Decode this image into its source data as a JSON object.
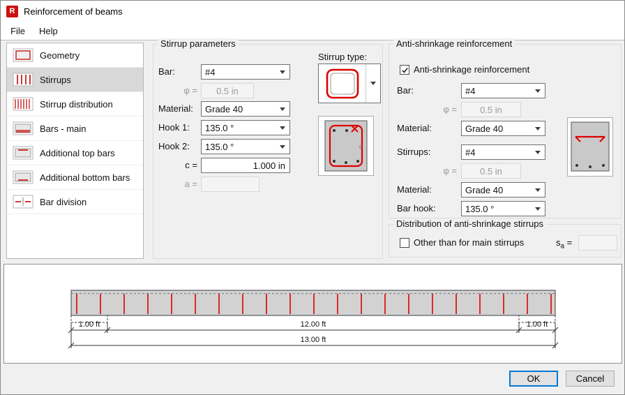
{
  "colors": {
    "accent_red": "#cc1111",
    "focus_blue": "#0078d7",
    "selection_gray": "#d8d8d8",
    "stirrup_red": "#dd0000"
  },
  "window": {
    "title": "Reinforcement of beams",
    "icon_letter": "R"
  },
  "menu": {
    "items": [
      {
        "label": "File"
      },
      {
        "label": "Help"
      }
    ]
  },
  "sidebar": {
    "selected": "Stirrups",
    "items": [
      {
        "label": "Geometry"
      },
      {
        "label": "Stirrups"
      },
      {
        "label": "Stirrup distribution"
      },
      {
        "label": "Bars - main"
      },
      {
        "label": "Additional top bars"
      },
      {
        "label": "Additional bottom bars"
      },
      {
        "label": "Bar division"
      }
    ]
  },
  "stirrup_parameters": {
    "group_title": "Stirrup parameters",
    "bar_label": "Bar:",
    "bar_value": "#4",
    "phi_label": "φ =",
    "phi_value": "0.5 in",
    "material_label": "Material:",
    "material_value": "Grade 40",
    "hook1_label": "Hook 1:",
    "hook1_value": "135.0 °",
    "hook2_label": "Hook 2:",
    "hook2_value": "135.0 °",
    "c_label": "c =",
    "c_value": "1.000 in",
    "a_label": "a =",
    "a_value": ""
  },
  "stirrup_type": {
    "label": "Stirrup type:"
  },
  "stirrup_preview": {
    "annotation": "c"
  },
  "anti_shrinkage": {
    "group_title": "Anti-shrinkage reinforcement",
    "checkbox_label": "Anti-shrinkage reinforcement",
    "checkbox_checked": true,
    "bar_label": "Bar:",
    "bar_value": "#4",
    "phi1_label": "φ =",
    "phi1_value": "0.5 in",
    "material1_label": "Material:",
    "material1_value": "Grade 40",
    "stirrups_label": "Stirrups:",
    "stirrups_value": "#4",
    "phi2_label": "φ =",
    "phi2_value": "0.5 in",
    "material2_label": "Material:",
    "material2_value": "Grade 40",
    "bar_hook_label": "Bar hook:",
    "bar_hook_value": "135.0 °"
  },
  "distribution": {
    "group_title": "Distribution of anti-shrinkage stirrups",
    "checkbox_label": "Other than for main stirrups",
    "checkbox_checked": false,
    "sa_s": "s",
    "sa_sub": "a",
    "sa_eq": " =",
    "sa_value": ""
  },
  "beam_drawing": {
    "dim_left": "1.00 ft",
    "dim_middle": "12.00 ft",
    "dim_right": "1.00 ft",
    "dim_total": "13.00 ft"
  },
  "footer": {
    "ok_label": "OK",
    "cancel_label": "Cancel"
  }
}
